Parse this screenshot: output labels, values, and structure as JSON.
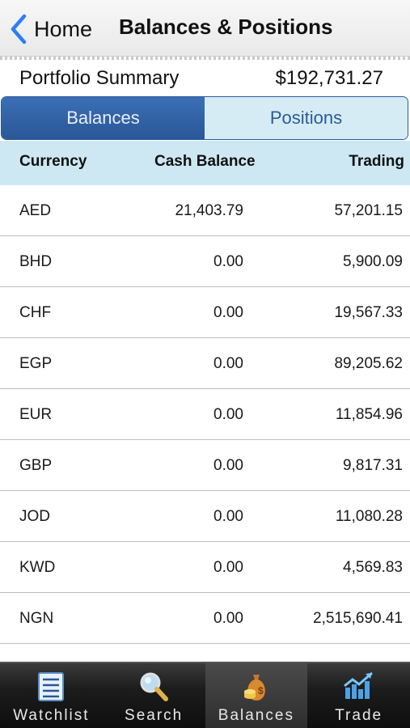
{
  "nav": {
    "back_label": "Home",
    "title": "Balances & Positions"
  },
  "summary": {
    "label": "Portfolio Summary",
    "value": "$192,731.27"
  },
  "segments": [
    {
      "label": "Balances",
      "active": true
    },
    {
      "label": "Positions",
      "active": false
    }
  ],
  "table": {
    "headers": {
      "currency": "Currency",
      "cash_balance": "Cash Balance",
      "trading": "Trading"
    },
    "rows": [
      {
        "currency": "AED",
        "cash": "21,403.79",
        "trading": "57,201.15"
      },
      {
        "currency": "BHD",
        "cash": "0.00",
        "trading": "5,900.09"
      },
      {
        "currency": "CHF",
        "cash": "0.00",
        "trading": "19,567.33"
      },
      {
        "currency": "EGP",
        "cash": "0.00",
        "trading": "89,205.62"
      },
      {
        "currency": "EUR",
        "cash": "0.00",
        "trading": "11,854.96"
      },
      {
        "currency": "GBP",
        "cash": "0.00",
        "trading": "9,817.31"
      },
      {
        "currency": "JOD",
        "cash": "0.00",
        "trading": "11,080.28"
      },
      {
        "currency": "KWD",
        "cash": "0.00",
        "trading": "4,569.83"
      },
      {
        "currency": "NGN",
        "cash": "0.00",
        "trading": "2,515,690.41"
      }
    ]
  },
  "tabbar": {
    "items": [
      {
        "label": "Watchlist",
        "icon": "list-icon",
        "selected": false
      },
      {
        "label": "Search",
        "icon": "magnifier-icon",
        "selected": false
      },
      {
        "label": "Balances",
        "icon": "money-bag-icon",
        "selected": true
      },
      {
        "label": "Trade",
        "icon": "chart-icon",
        "selected": false
      }
    ]
  },
  "colors": {
    "accent": "#2a5797",
    "header_bg": "#cde8f3",
    "segment_inactive": "#d6ecf4"
  }
}
